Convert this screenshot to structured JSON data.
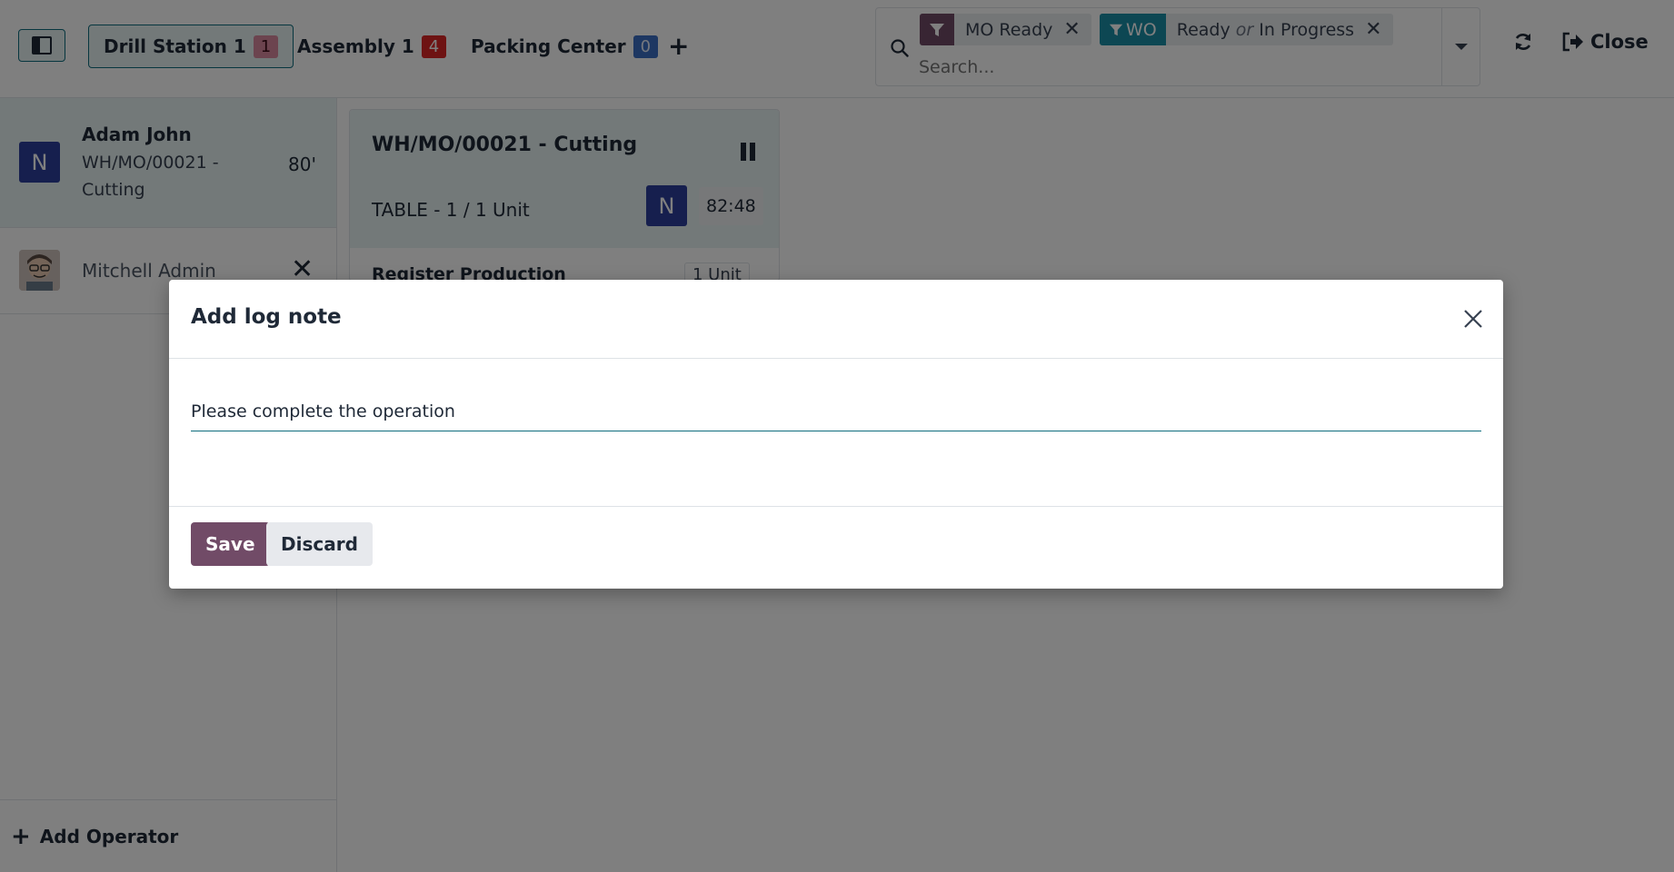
{
  "topbar": {
    "workcenters": [
      {
        "label": "Drill Station 1",
        "count": "1"
      },
      {
        "label": "Assembly 1",
        "count": "4"
      },
      {
        "label": "Packing Center",
        "count": "0"
      }
    ],
    "search": {
      "facets": [
        {
          "tag_icon": "filter-icon",
          "value": "MO Ready"
        },
        {
          "tag": "WO",
          "value_a": "Ready",
          "or": "or",
          "value_b": "In Progress"
        }
      ],
      "placeholder": "Search..."
    },
    "close_label": "Close"
  },
  "operators": [
    {
      "avatar_letter": "N",
      "name": "Adam John",
      "workorder": "WH/MO/00021 - Cutting",
      "time": "80'"
    },
    {
      "name": "Mitchell Admin"
    }
  ],
  "add_operator_label": "Add Operator",
  "workorder_card": {
    "title": "WH/MO/00021 - Cutting",
    "product": "TABLE - 1 / 1 Unit",
    "avatar_letter": "N",
    "timer": "82:48",
    "step": "Register Production",
    "step_qty": "1 Unit"
  },
  "dialog": {
    "title": "Add log note",
    "note_value": "Please complete the operation",
    "save_label": "Save",
    "discard_label": "Discard"
  },
  "colors": {
    "accent": "#0f6d7e",
    "primary_button": "#714b67",
    "active_bg": "#e6f2f3",
    "mo_facet_tag": "#714b67",
    "wo_facet_tag": "#1a8fa6"
  }
}
